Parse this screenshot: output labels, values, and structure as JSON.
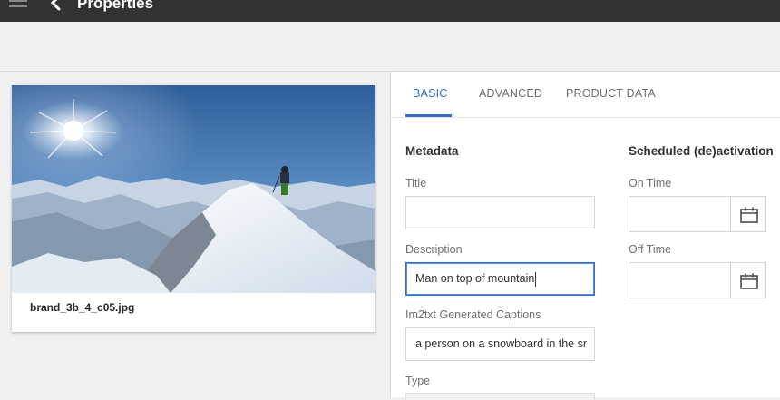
{
  "header": {
    "title": "Properties",
    "menu_icon": "hamburger-icon",
    "back_icon": "chevron-left-icon"
  },
  "asset": {
    "filename": "brand_3b_4_c05.jpg",
    "image_subject": "mountain-snowboarder-photo"
  },
  "tabs": [
    {
      "label": "BASIC",
      "active": true
    },
    {
      "label": "ADVANCED",
      "active": false
    },
    {
      "label": "PRODUCT DATA",
      "active": false
    }
  ],
  "metadata": {
    "heading": "Metadata",
    "title_label": "Title",
    "title_value": "",
    "description_label": "Description",
    "description_value": "Man on top of mountain",
    "captions_label": "Im2txt Generated Captions",
    "captions_value": "a person on a snowboard in the sr",
    "type_label": "Type"
  },
  "schedule": {
    "heading": "Scheduled (de)activation",
    "on_time_label": "On Time",
    "on_time_value": "",
    "off_time_label": "Off Time",
    "off_time_value": "",
    "calendar_icon": "calendar-icon"
  },
  "colors": {
    "accent": "#326ec8",
    "topbar": "#323232",
    "background": "#f0f0f0"
  }
}
